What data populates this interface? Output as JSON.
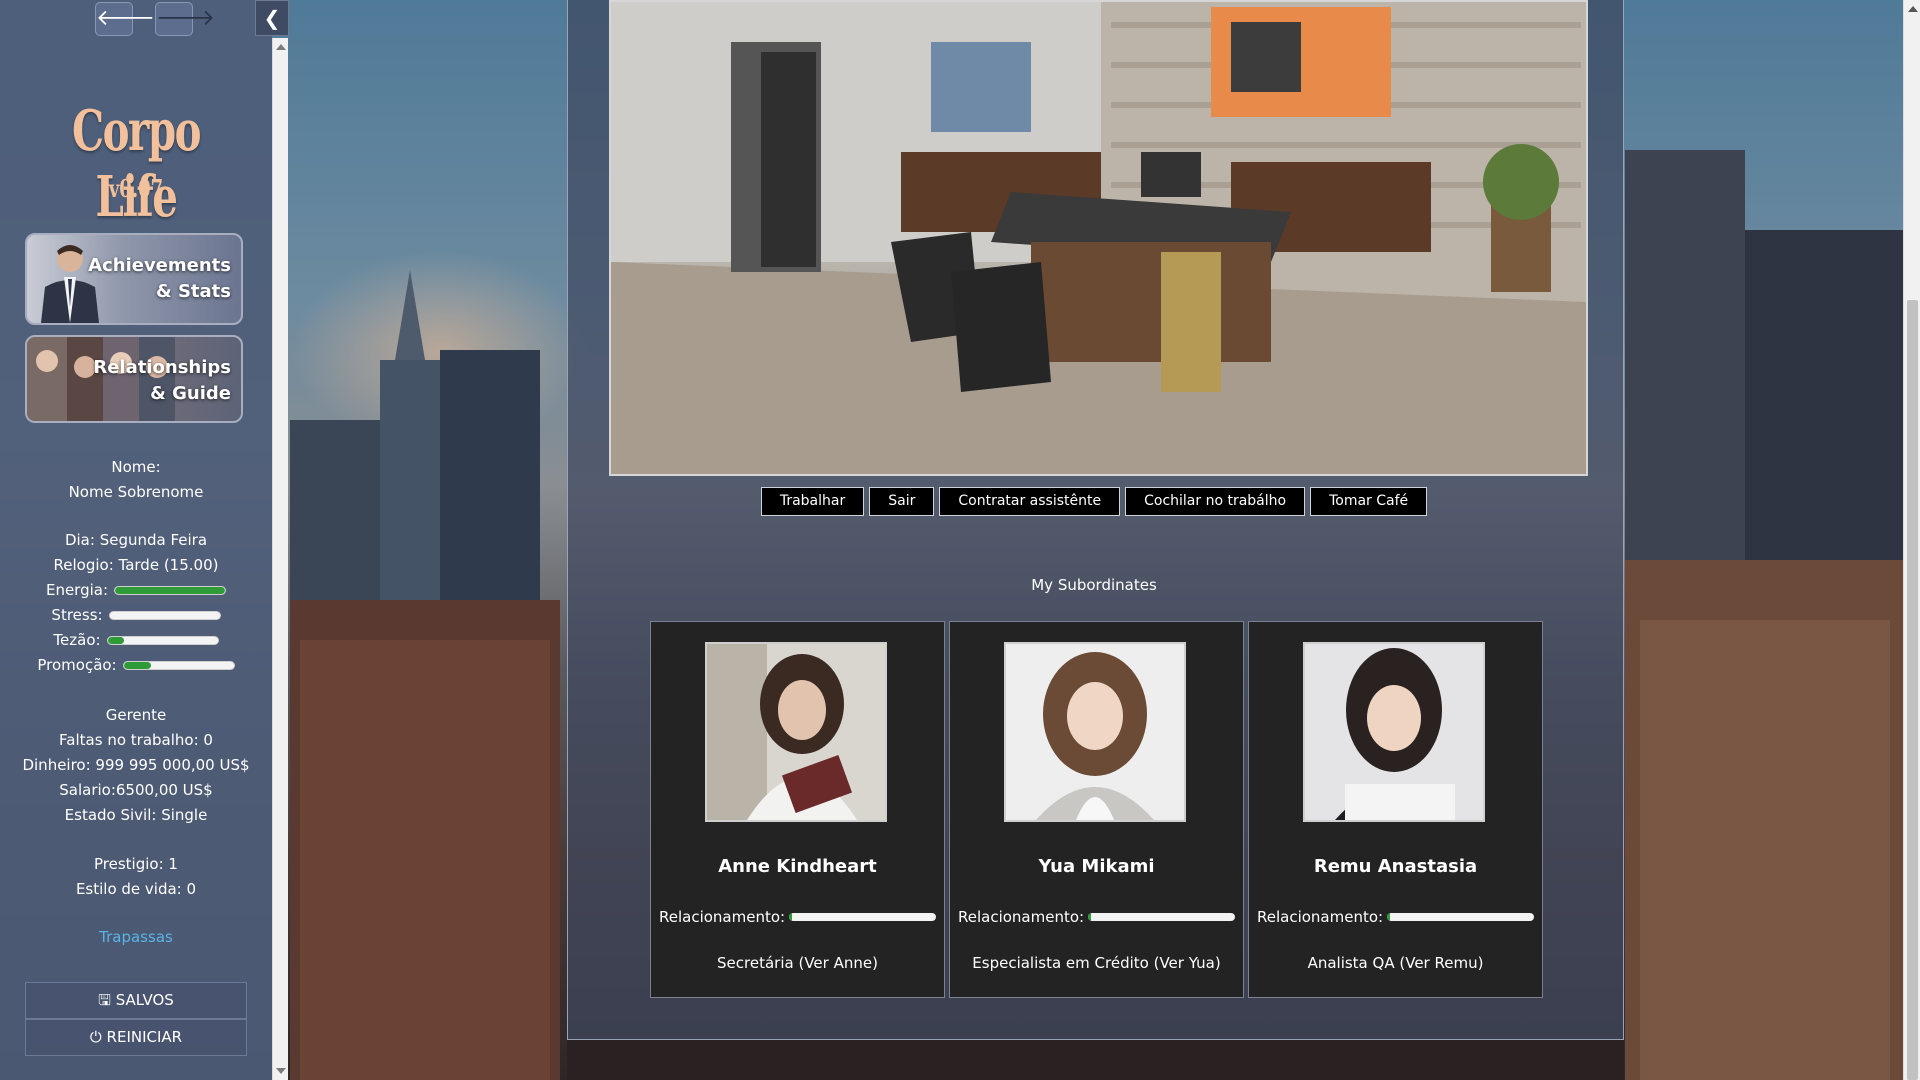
{
  "nav": {
    "back_icon": "arrow-left-icon",
    "forward_icon": "arrow-right-icon",
    "collapse_icon": "chevron-left-icon"
  },
  "game": {
    "title": "Corpo Life",
    "version": "v0.07"
  },
  "banners": {
    "achievements": [
      "Achievements",
      "& Stats"
    ],
    "relationships": [
      "Relationships",
      "& Guide"
    ]
  },
  "player": {
    "name_label": "Nome:",
    "name_value": "Nome Sobrenome",
    "day": "Dia: Segunda Feira",
    "clock": "Relogio: Tarde (15.00)",
    "meters": [
      {
        "label": "Energia:",
        "value": 1.0
      },
      {
        "label": "Stress:",
        "value": 0.0
      },
      {
        "label": "Tezão:",
        "value": 0.15
      },
      {
        "label": "Promoção:",
        "value": 0.25
      }
    ],
    "position": "Gerente",
    "absences": "Faltas no trabalho: 0",
    "money": "Dinheiro: 999 995 000,00 US$",
    "salary": "Salario:6500,00 US$",
    "civil_status": "Estado Sivil: Single",
    "prestige": "Prestigio: 1",
    "lifestyle": "Estilo de vida: 0",
    "cheats_link": "Trapassas"
  },
  "menu": {
    "save_label": "SALVOS",
    "save_icon": "floppy-disk-icon",
    "restart_label": "REINICIAR",
    "restart_icon": "power-icon"
  },
  "actions": [
    "Trabalhar",
    "Sair",
    "Contratar assistênte",
    "Cochilar no trabálho",
    "Tomar Café"
  ],
  "subordinates_title": "My Subordinates",
  "subordinates": [
    {
      "name": "Anne Kindheart",
      "rel_label": "Relacionamento:",
      "relationship": 0.02,
      "role": "Secretária",
      "link": "(Ver Anne)"
    },
    {
      "name": "Yua Mikami",
      "rel_label": "Relacionamento:",
      "relationship": 0.02,
      "role": "Especialista em Crédito",
      "link": "(Ver Yua)"
    },
    {
      "name": "Remu Anastasia",
      "rel_label": "Relacionamento:",
      "relationship": 0.02,
      "role": "Analista QA",
      "link": "(Ver Remu)"
    }
  ],
  "colors": {
    "accent_green": "#2f9b37",
    "title_peach": "#f2c09a",
    "link_blue": "#5ab4e6",
    "sidebar": "#4e5c78"
  }
}
